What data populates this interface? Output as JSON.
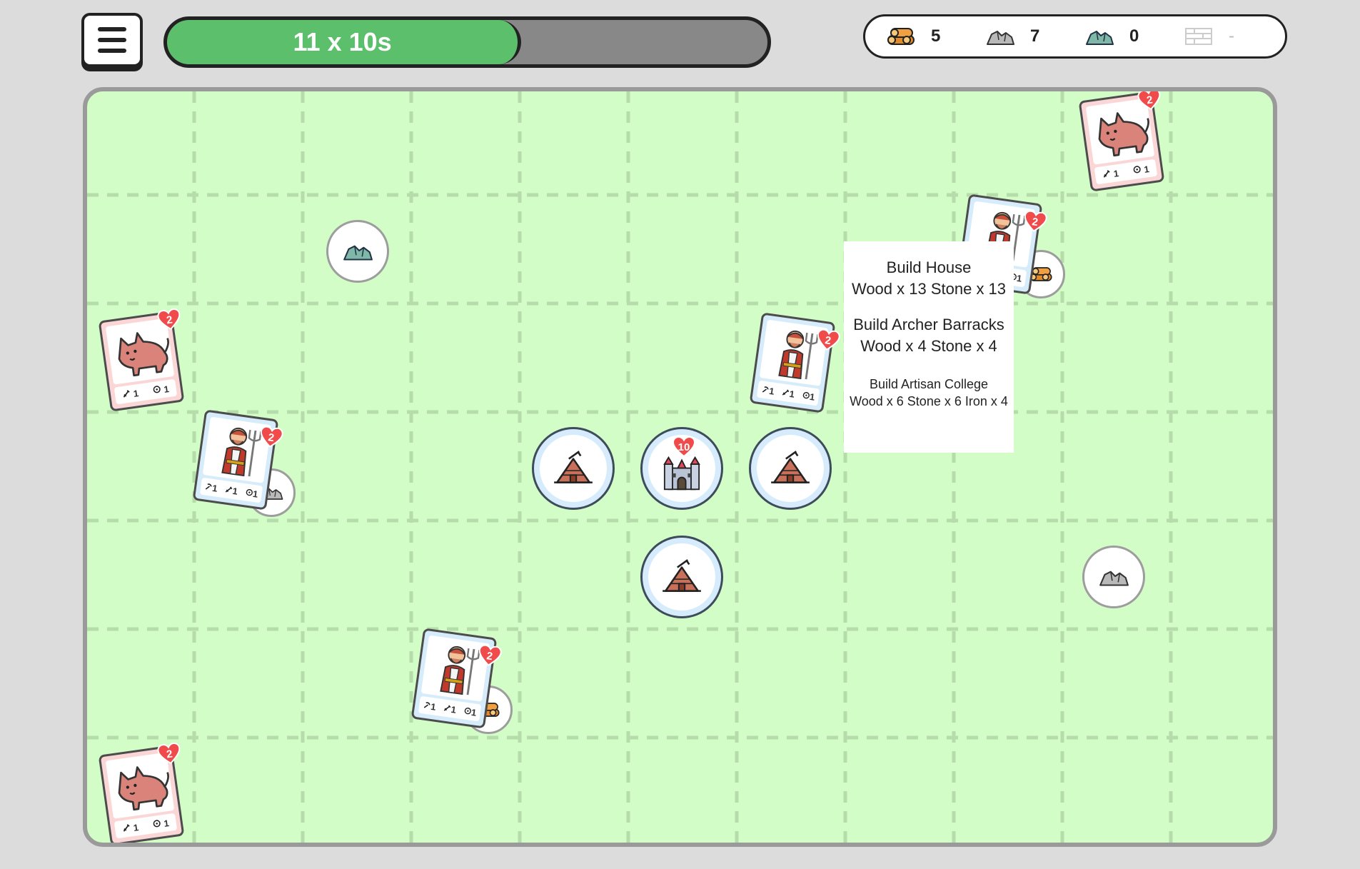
{
  "hud": {
    "menu_icon": "hamburger-menu-icon",
    "timer_label": "11 x 10s",
    "timer_progress": 0.59,
    "progress_fill_color": "#5cbf6b"
  },
  "resources": [
    {
      "name": "wood",
      "icon": "wood-logs-icon",
      "value": "5"
    },
    {
      "name": "stone",
      "icon": "stone-icon",
      "value": "7"
    },
    {
      "name": "iron",
      "icon": "iron-ore-icon",
      "value": "0"
    },
    {
      "name": "locked",
      "icon": "brick-icon",
      "value": "-"
    }
  ],
  "board": {
    "castle": {
      "icon": "castle-icon",
      "hp": "10"
    },
    "buildings": [
      {
        "icon": "hut-icon"
      },
      {
        "icon": "hut-icon"
      },
      {
        "icon": "hut-icon"
      }
    ],
    "wolves": [
      {
        "hp": "2",
        "attack": "1",
        "range": "1"
      },
      {
        "hp": "2",
        "attack": "1",
        "range": "1"
      },
      {
        "hp": "2",
        "attack": "1",
        "range": "1"
      }
    ],
    "farmers": [
      {
        "hp": "2",
        "gather": "1",
        "attack": "1",
        "range": "1"
      },
      {
        "hp": "2",
        "gather": "1",
        "attack": "1",
        "range": "1"
      },
      {
        "hp": "2",
        "gather": "1",
        "attack": "1",
        "range": "1"
      },
      {
        "hp": "2",
        "gather": "1",
        "attack": "1",
        "range": "1"
      }
    ]
  },
  "build_menu": {
    "items": [
      {
        "title": "Build House",
        "cost": "Wood x 13 Stone x 13"
      },
      {
        "title": "Build Archer Barracks",
        "cost": "Wood x 4 Stone x 4"
      },
      {
        "title": "Build Artisan College",
        "cost": "Wood x 6 Stone x 6 Iron x 4"
      }
    ]
  }
}
